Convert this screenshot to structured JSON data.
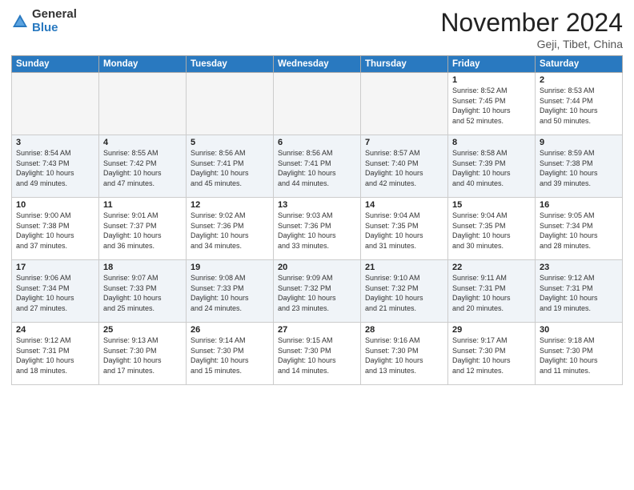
{
  "header": {
    "logo_general": "General",
    "logo_blue": "Blue",
    "month_title": "November 2024",
    "location": "Geji, Tibet, China"
  },
  "weekdays": [
    "Sunday",
    "Monday",
    "Tuesday",
    "Wednesday",
    "Thursday",
    "Friday",
    "Saturday"
  ],
  "weeks": [
    [
      {
        "day": "",
        "empty": true
      },
      {
        "day": "",
        "empty": true
      },
      {
        "day": "",
        "empty": true
      },
      {
        "day": "",
        "empty": true
      },
      {
        "day": "",
        "empty": true
      },
      {
        "day": "1",
        "sunrise": "8:52 AM",
        "sunset": "7:45 PM",
        "daylight": "10 hours and 52 minutes."
      },
      {
        "day": "2",
        "sunrise": "8:53 AM",
        "sunset": "7:44 PM",
        "daylight": "10 hours and 50 minutes."
      }
    ],
    [
      {
        "day": "3",
        "sunrise": "8:54 AM",
        "sunset": "7:43 PM",
        "daylight": "10 hours and 49 minutes."
      },
      {
        "day": "4",
        "sunrise": "8:55 AM",
        "sunset": "7:42 PM",
        "daylight": "10 hours and 47 minutes."
      },
      {
        "day": "5",
        "sunrise": "8:56 AM",
        "sunset": "7:41 PM",
        "daylight": "10 hours and 45 minutes."
      },
      {
        "day": "6",
        "sunrise": "8:56 AM",
        "sunset": "7:41 PM",
        "daylight": "10 hours and 44 minutes."
      },
      {
        "day": "7",
        "sunrise": "8:57 AM",
        "sunset": "7:40 PM",
        "daylight": "10 hours and 42 minutes."
      },
      {
        "day": "8",
        "sunrise": "8:58 AM",
        "sunset": "7:39 PM",
        "daylight": "10 hours and 40 minutes."
      },
      {
        "day": "9",
        "sunrise": "8:59 AM",
        "sunset": "7:38 PM",
        "daylight": "10 hours and 39 minutes."
      }
    ],
    [
      {
        "day": "10",
        "sunrise": "9:00 AM",
        "sunset": "7:38 PM",
        "daylight": "10 hours and 37 minutes."
      },
      {
        "day": "11",
        "sunrise": "9:01 AM",
        "sunset": "7:37 PM",
        "daylight": "10 hours and 36 minutes."
      },
      {
        "day": "12",
        "sunrise": "9:02 AM",
        "sunset": "7:36 PM",
        "daylight": "10 hours and 34 minutes."
      },
      {
        "day": "13",
        "sunrise": "9:03 AM",
        "sunset": "7:36 PM",
        "daylight": "10 hours and 33 minutes."
      },
      {
        "day": "14",
        "sunrise": "9:04 AM",
        "sunset": "7:35 PM",
        "daylight": "10 hours and 31 minutes."
      },
      {
        "day": "15",
        "sunrise": "9:04 AM",
        "sunset": "7:35 PM",
        "daylight": "10 hours and 30 minutes."
      },
      {
        "day": "16",
        "sunrise": "9:05 AM",
        "sunset": "7:34 PM",
        "daylight": "10 hours and 28 minutes."
      }
    ],
    [
      {
        "day": "17",
        "sunrise": "9:06 AM",
        "sunset": "7:34 PM",
        "daylight": "10 hours and 27 minutes."
      },
      {
        "day": "18",
        "sunrise": "9:07 AM",
        "sunset": "7:33 PM",
        "daylight": "10 hours and 25 minutes."
      },
      {
        "day": "19",
        "sunrise": "9:08 AM",
        "sunset": "7:33 PM",
        "daylight": "10 hours and 24 minutes."
      },
      {
        "day": "20",
        "sunrise": "9:09 AM",
        "sunset": "7:32 PM",
        "daylight": "10 hours and 23 minutes."
      },
      {
        "day": "21",
        "sunrise": "9:10 AM",
        "sunset": "7:32 PM",
        "daylight": "10 hours and 21 minutes."
      },
      {
        "day": "22",
        "sunrise": "9:11 AM",
        "sunset": "7:31 PM",
        "daylight": "10 hours and 20 minutes."
      },
      {
        "day": "23",
        "sunrise": "9:12 AM",
        "sunset": "7:31 PM",
        "daylight": "10 hours and 19 minutes."
      }
    ],
    [
      {
        "day": "24",
        "sunrise": "9:12 AM",
        "sunset": "7:31 PM",
        "daylight": "10 hours and 18 minutes."
      },
      {
        "day": "25",
        "sunrise": "9:13 AM",
        "sunset": "7:30 PM",
        "daylight": "10 hours and 17 minutes."
      },
      {
        "day": "26",
        "sunrise": "9:14 AM",
        "sunset": "7:30 PM",
        "daylight": "10 hours and 15 minutes."
      },
      {
        "day": "27",
        "sunrise": "9:15 AM",
        "sunset": "7:30 PM",
        "daylight": "10 hours and 14 minutes."
      },
      {
        "day": "28",
        "sunrise": "9:16 AM",
        "sunset": "7:30 PM",
        "daylight": "10 hours and 13 minutes."
      },
      {
        "day": "29",
        "sunrise": "9:17 AM",
        "sunset": "7:30 PM",
        "daylight": "10 hours and 12 minutes."
      },
      {
        "day": "30",
        "sunrise": "9:18 AM",
        "sunset": "7:30 PM",
        "daylight": "10 hours and 11 minutes."
      }
    ]
  ]
}
